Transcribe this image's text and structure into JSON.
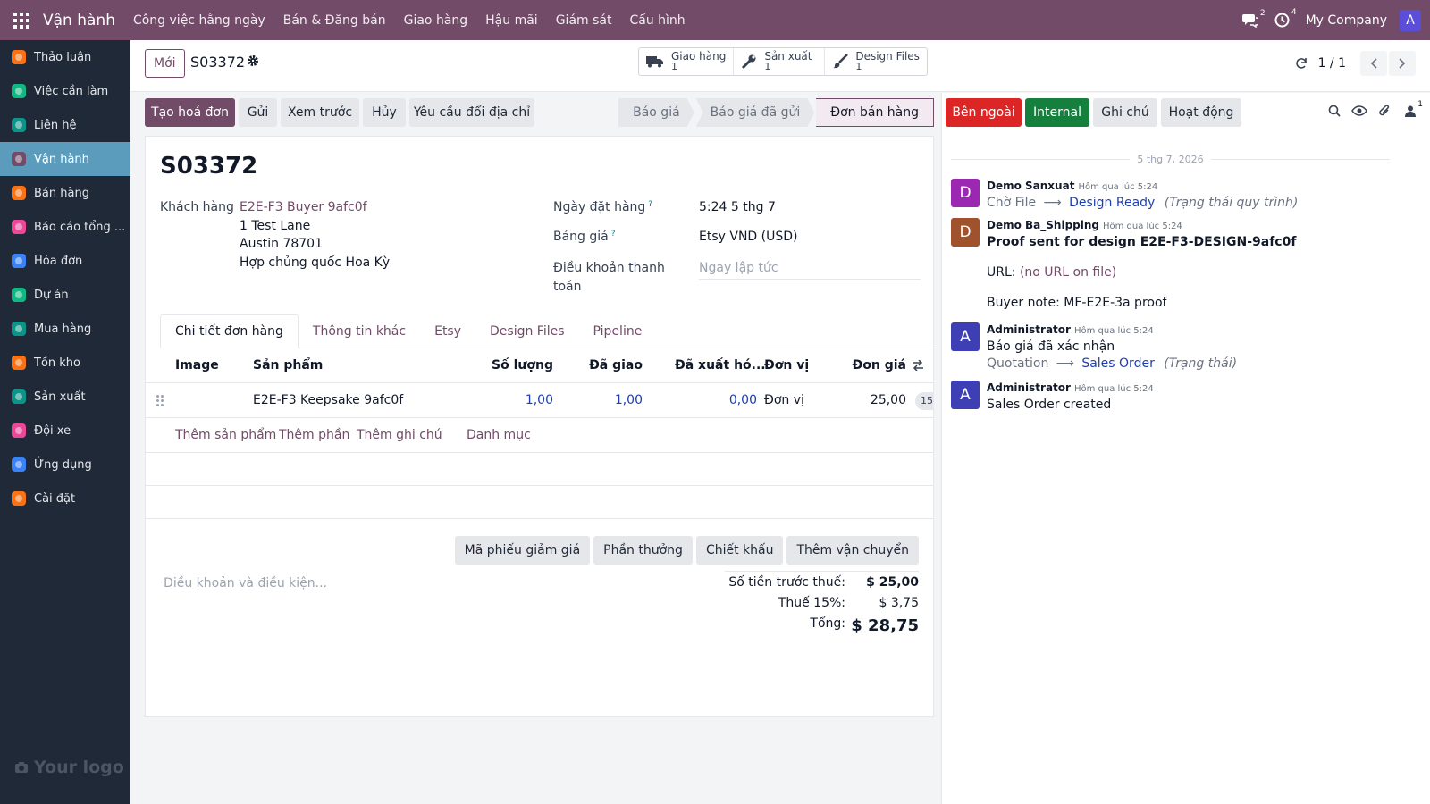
{
  "topbar": {
    "brand": "Vận hành",
    "menu": [
      "Công việc hằng ngày",
      "Bán & Đăng bán",
      "Giao hàng",
      "Hậu mãi",
      "Giám sát",
      "Cấu hình"
    ],
    "discuss_count": "2",
    "activity_count": "4",
    "company": "My Company",
    "avatar_letter": "A",
    "accent_color": "#714b67"
  },
  "sidebar": {
    "items": [
      {
        "label": "Thảo luận",
        "icon": "discuss-icon",
        "color": "#f97316"
      },
      {
        "label": "Việc cần làm",
        "icon": "todo-icon",
        "color": "#10b981"
      },
      {
        "label": "Liên hệ",
        "icon": "contacts-icon",
        "color": "#0d9488"
      },
      {
        "label": "Vận hành",
        "icon": "operations-icon",
        "color": "#714b67"
      },
      {
        "label": "Bán hàng",
        "icon": "sales-icon",
        "color": "#f97316"
      },
      {
        "label": "Báo cáo tổng ...",
        "icon": "reports-icon",
        "color": "#ec4899"
      },
      {
        "label": "Hóa đơn",
        "icon": "invoice-icon",
        "color": "#3b82f6"
      },
      {
        "label": "Dự án",
        "icon": "project-icon",
        "color": "#10b981"
      },
      {
        "label": "Mua hàng",
        "icon": "purchase-icon",
        "color": "#0d9488"
      },
      {
        "label": "Tồn kho",
        "icon": "inventory-icon",
        "color": "#f97316"
      },
      {
        "label": "Sản xuất",
        "icon": "manufacturing-icon",
        "color": "#0d9488"
      },
      {
        "label": "Đội xe",
        "icon": "fleet-icon",
        "color": "#ec4899"
      },
      {
        "label": "Ứng dụng",
        "icon": "apps-store-icon",
        "color": "#3b82f6"
      },
      {
        "label": "Cài đặt",
        "icon": "settings-icon",
        "color": "#f97316"
      }
    ],
    "active_index": 3,
    "logo_text": "Your logo"
  },
  "control": {
    "new_label": "Mới",
    "record_name": "S03372",
    "smart_buttons": [
      {
        "label": "Giao hàng",
        "value": "1",
        "icon": "truck-icon"
      },
      {
        "label": "Sản xuất",
        "value": "1",
        "icon": "wrench-icon"
      },
      {
        "label": "Design Files",
        "value": "1",
        "icon": "brush-icon"
      }
    ],
    "pager": "1 / 1"
  },
  "form": {
    "actions": [
      "Tạo hoá đơn",
      "Gửi",
      "Xem trước",
      "Hủy",
      "Yêu cầu đổi địa chỉ"
    ],
    "stages": [
      "Báo giá",
      "Báo giá đã gửi",
      "Đơn bán hàng"
    ],
    "active_stage": "Đơn bán hàng",
    "title": "S03372",
    "customer_label": "Khách hàng",
    "customer_name": "E2E-F3 Buyer 9afc0f",
    "customer_address": [
      "1 Test Lane",
      "Austin 78701",
      "Hợp chủng quốc Hoa Kỳ"
    ],
    "order_date_label": "Ngày đặt hàng",
    "order_date": "5:24 5 thg 7",
    "pricelist_label": "Bảng giá",
    "pricelist": "Etsy VND (USD)",
    "payment_terms_label_1": "Điều khoản thanh",
    "payment_terms_label_2": "toán",
    "payment_terms_placeholder": "Ngay lập tức",
    "help_mark": "?",
    "tabs": [
      "Chi tiết đơn hàng",
      "Thông tin khác",
      "Etsy",
      "Design Files",
      "Pipeline"
    ],
    "table": {
      "headers": {
        "image": "Image",
        "product": "Sản phẩm",
        "qty": "Số lượng",
        "delivered": "Đã giao",
        "invoiced": "Đã xuất hó...",
        "uom": "Đơn vị",
        "price": "Đơn giá"
      },
      "rows": [
        {
          "product": "E2E-F3 Keepsake 9afc0f",
          "qty": "1,00",
          "delivered": "1,00",
          "invoiced": "0,00",
          "uom": "Đơn vị",
          "price": "25,00",
          "tax_cut": "15"
        }
      ],
      "add_links": [
        "Thêm sản phẩm",
        "Thêm phần",
        "Thêm ghi chú",
        "Danh mục"
      ]
    },
    "promo_buttons": [
      "Mã phiếu giảm giá",
      "Phần thưởng",
      "Chiết khấu",
      "Thêm vận chuyển"
    ],
    "terms_placeholder": "Điều khoản và điều kiện...",
    "totals": {
      "untaxed_label": "Số tiền trước thuế:",
      "untaxed": "$ 25,00",
      "tax_label": "Thuế 15%:",
      "tax": "$ 3,75",
      "total_label": "Tổng:",
      "total": "$ 28,75"
    }
  },
  "chatter": {
    "buttons": [
      {
        "label": "Bên ngoài",
        "color": "#dc2626"
      },
      {
        "label": "Internal",
        "color": "#15803d"
      },
      {
        "label": "Ghi chú",
        "color": "#e5e7eb"
      },
      {
        "label": "Hoạt động",
        "color": "#e5e7eb"
      }
    ],
    "followers_count": "1",
    "date_separator": "5 thg 7, 2026",
    "messages": [
      {
        "avatar": "D",
        "avatar_color": "#9c27b0",
        "author": "Demo Sanxuat",
        "time": "Hôm qua lúc 5:24",
        "track_old": "Chờ File",
        "track_new": "Design Ready",
        "track_field": "(Trạng thái quy trình)"
      },
      {
        "avatar": "D",
        "avatar_color": "#a0522d",
        "author": "Demo Ba_Shipping",
        "time": "Hôm qua lúc 5:24",
        "title": "Proof sent for design E2E-F3-DESIGN-9afc0f",
        "url_label": "URL:",
        "url_value": "(no URL on file)",
        "note": "Buyer note: MF-E2E-3a proof"
      },
      {
        "avatar": "A",
        "avatar_color": "#3f3fb5",
        "author": "Administrator",
        "time": "Hôm qua lúc 5:24",
        "body": "Báo giá đã xác nhận",
        "track_old": "Quotation",
        "track_new": "Sales Order",
        "track_field": "(Trạng thái)"
      },
      {
        "avatar": "A",
        "avatar_color": "#3f3fb5",
        "author": "Administrator",
        "time": "Hôm qua lúc 5:24",
        "body": "Sales Order created"
      }
    ]
  }
}
